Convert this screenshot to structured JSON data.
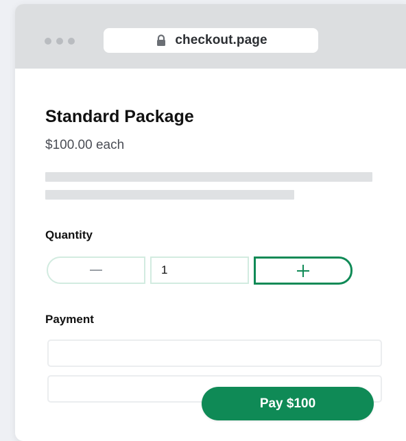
{
  "browser": {
    "url": "checkout.page",
    "lock_icon": "lock-icon",
    "window_dot_color": "#b9bcc0"
  },
  "product": {
    "title": "Standard Package",
    "price": "$100.00 each"
  },
  "quantity": {
    "label": "Quantity",
    "value": "1",
    "decrement_icon": "minus-icon",
    "increment_icon": "plus-icon"
  },
  "payment": {
    "label": "Payment",
    "card_field_value": "",
    "details_field_value": "",
    "pay_button_label": "Pay $100"
  },
  "colors": {
    "accent": "#0f8a56",
    "accent_light_border": "#d2ebe0",
    "titlebar": "#dcdee0",
    "skeleton": "#dfe1e3"
  }
}
